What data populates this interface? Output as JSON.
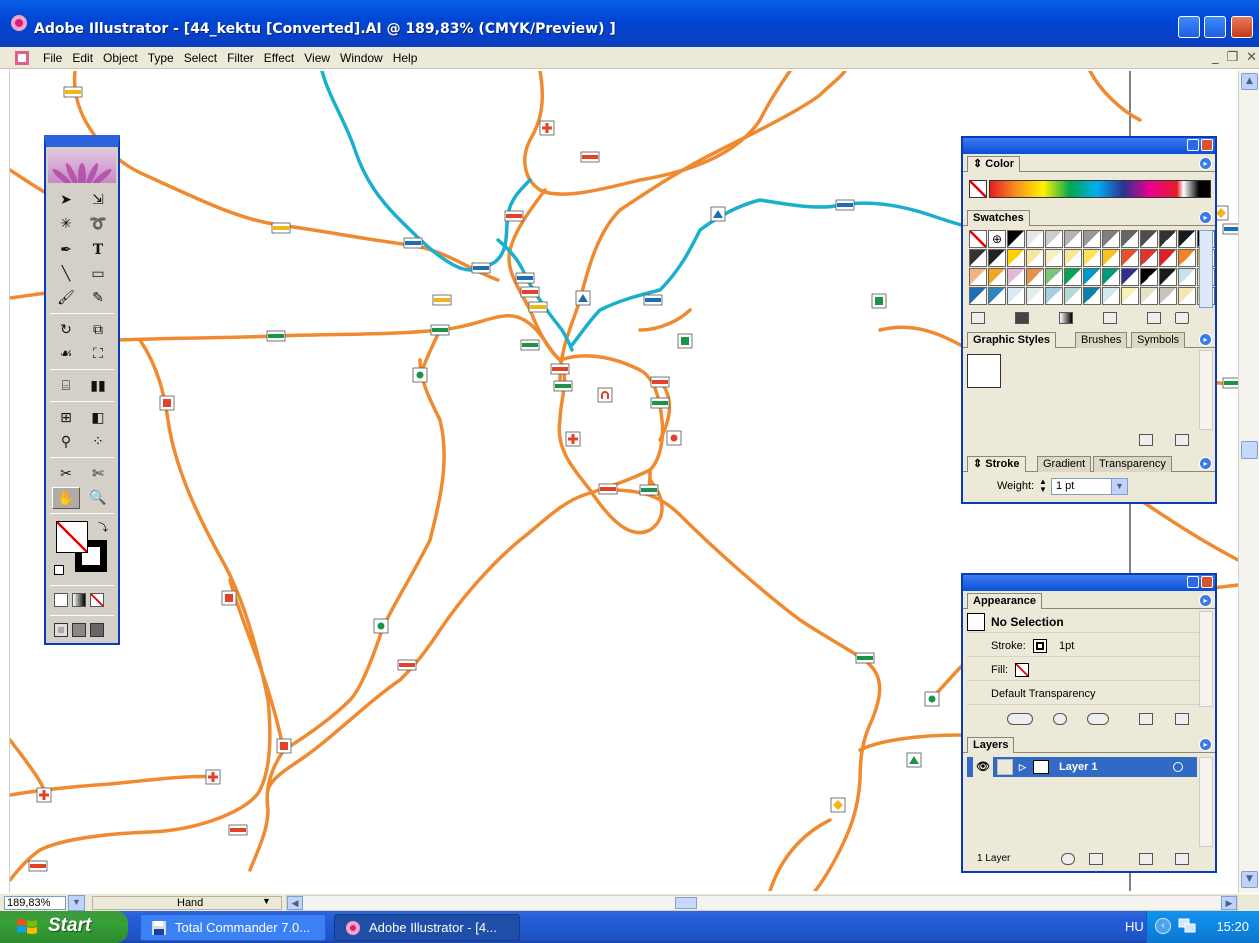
{
  "window": {
    "title": "Adobe Illustrator - [44_kektu [Converted].AI @ 189,83% (CMYK/Preview) ]"
  },
  "menu": {
    "items": [
      "File",
      "Edit",
      "Object",
      "Type",
      "Select",
      "Filter",
      "Effect",
      "View",
      "Window",
      "Help"
    ]
  },
  "palettes": {
    "color": {
      "tab": "Color"
    },
    "swatches": {
      "tab": "Swatches"
    },
    "graphic_styles": {
      "tabs": [
        "Graphic Styles",
        "Brushes",
        "Symbols"
      ]
    },
    "stroke": {
      "tabs": [
        "Stroke",
        "Gradient",
        "Transparency"
      ],
      "weight_label": "Weight:",
      "weight_value": "1 pt"
    },
    "appearance": {
      "tab": "Appearance",
      "selection": "No Selection",
      "stroke_label": "Stroke:",
      "stroke_value": "1pt",
      "fill_label": "Fill:",
      "transparency": "Default Transparency"
    },
    "layers": {
      "tab": "Layers",
      "layer_name": "Layer 1",
      "count": "1 Layer"
    }
  },
  "statusbar": {
    "zoom": "189,83%",
    "tool": "Hand"
  },
  "taskbar": {
    "start": "Start",
    "tasks": [
      "Total Commander 7.0...",
      "Adobe Illustrator - [4..."
    ],
    "language": "HU",
    "clock": "15:20"
  },
  "colors": {
    "orange_trail": "#f08a30",
    "cyan_trail": "#1ab0cc",
    "blue_marker": "#1c6fb3",
    "red_marker": "#e2412a",
    "green_marker": "#1a9448",
    "yellow_marker": "#f2b41b",
    "xp_blue": "#0046d5"
  },
  "swatch_colors": [
    "#ffffff",
    "#ffffff",
    "#000000",
    "#e6e6e6",
    "#cccccc",
    "#b3b3b3",
    "#999999",
    "#808080",
    "#666666",
    "#4d4d4d",
    "#333333",
    "#1a1a1a",
    "#000000",
    "#333333",
    "#222222",
    "#ffd100",
    "#f5e6a0",
    "#f4f0c0",
    "#f7e59b",
    "#ffe25a",
    "#f5c31f",
    "#e84f2b",
    "#e0352a",
    "#e21f26",
    "#f58220",
    "#f3a21a",
    "#f4b183",
    "#f2a81d",
    "#e6b8d8",
    "#e6914b",
    "#7dc47a",
    "#00a651",
    "#0099cc",
    "#009b77",
    "#2e3192",
    "#000000",
    "#1c1c1c",
    "#c8e1e8",
    "#f4d7a0",
    "#1c6fb3",
    "#2e86c1",
    "#d6ebf5",
    "#e0f0e8",
    "#a6cee3",
    "#b3d9d0",
    "#0d7fa8",
    "#cfe8ee",
    "#f7f1b5",
    "#e8e3c6",
    "#c8c4bb",
    "#f4e7b3",
    "#f1c27d"
  ]
}
